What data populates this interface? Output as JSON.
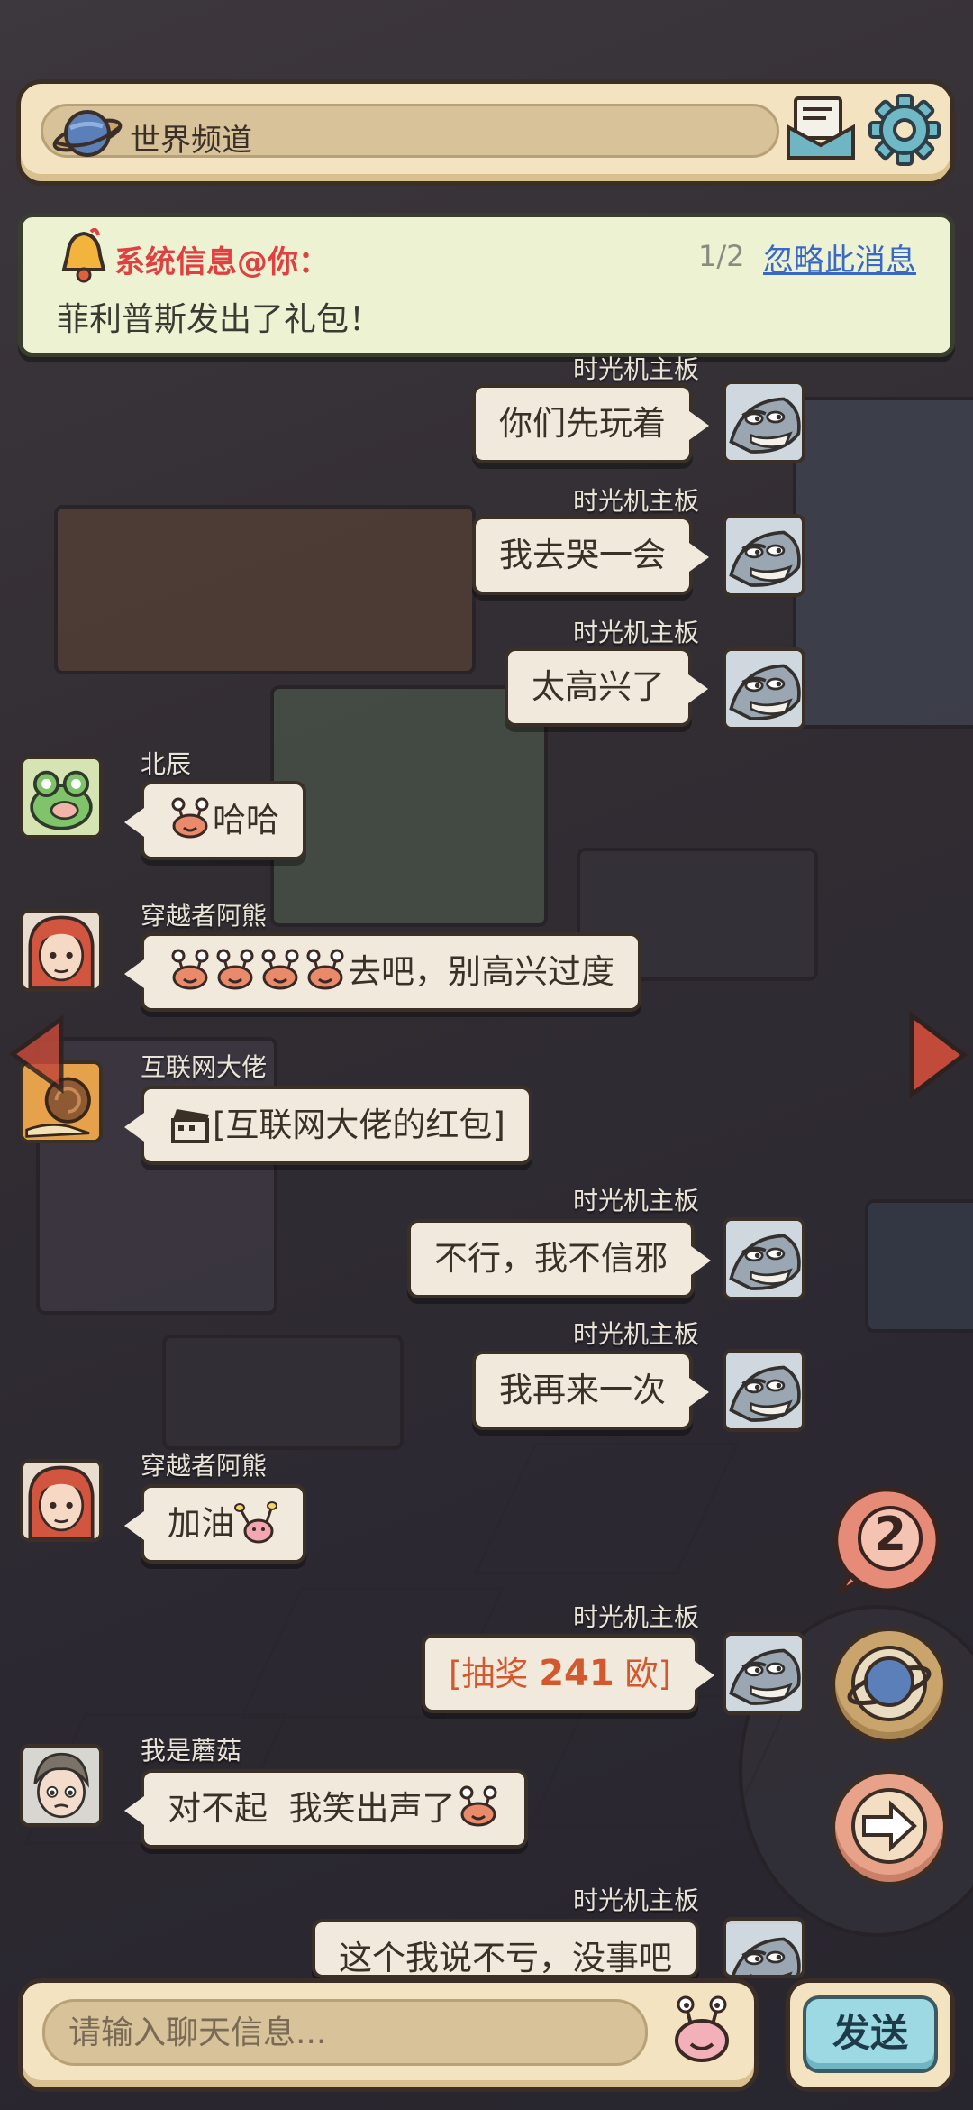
{
  "header": {
    "channel_label": "世界频道"
  },
  "notice": {
    "title": "系统信息@你：",
    "page": "1/2",
    "ignore_label": "忽略此消息",
    "text": "菲利普斯发出了礼包！"
  },
  "messages": [
    {
      "side": "right",
      "sender": "时光机主板",
      "text": "你们先玩着"
    },
    {
      "side": "right",
      "sender": "时光机主板",
      "text": "我去哭一会"
    },
    {
      "side": "right",
      "sender": "时光机主板",
      "text": "太高兴了"
    },
    {
      "side": "left",
      "sender": "北辰",
      "text": "哈哈"
    },
    {
      "side": "left",
      "sender": "穿越者阿熊",
      "text": "去吧，别高兴过度"
    },
    {
      "side": "left",
      "sender": "互联网大佬",
      "text": "[互联网大佬的红包]"
    },
    {
      "side": "right",
      "sender": "时光机主板",
      "text": "不行，我不信邪"
    },
    {
      "side": "right",
      "sender": "时光机主板",
      "text": "我再来一次"
    },
    {
      "side": "left",
      "sender": "穿越者阿熊",
      "text": "加油"
    },
    {
      "side": "right",
      "sender": "时光机主板",
      "text_prefix": "[抽奖 ",
      "number": "241",
      "text_suffix": " 欧]"
    },
    {
      "side": "left",
      "sender": "我是蘑菇",
      "text": "对不起  我笑出声了"
    },
    {
      "side": "right",
      "sender": "时光机主板",
      "text": "这个我说不亏，没事吧"
    }
  ],
  "side_buttons": {
    "badge_count": "2"
  },
  "input": {
    "placeholder": "请输入聊天信息..."
  },
  "send_label": "发送",
  "colors": {
    "notice_title": "#e04040",
    "ignore_link": "#3a68c8",
    "lottery": "#d4582e",
    "panel": "#f3e3c0",
    "send_button": "#9cd9e3"
  }
}
